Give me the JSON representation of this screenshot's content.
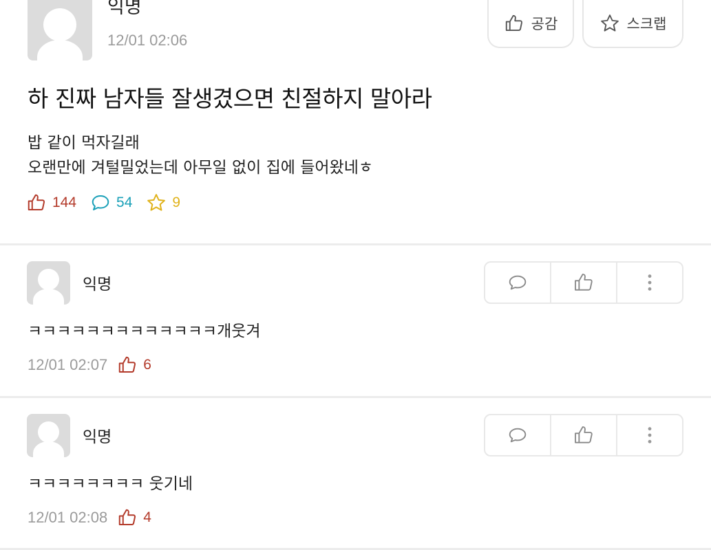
{
  "post": {
    "author": "익명",
    "time": "12/01 02:06",
    "like_button_label": "공감",
    "scrap_button_label": "스크랩",
    "title": "하 진짜 남자들 잘생겼으면 친절하지 말아라",
    "body_line1": "밥 같이 먹자길래",
    "body_line2": "오랜만에 겨털밀었는데 아무일 없이 집에 들어왔네ㅎ",
    "likes": "144",
    "comments": "54",
    "scraps": "9"
  },
  "comments": [
    {
      "author": "익명",
      "text": "ㅋㅋㅋㅋㅋㅋㅋㅋㅋㅋㅋㅋㅋ개웃겨",
      "time": "12/01 02:07",
      "likes": "6"
    },
    {
      "author": "익명",
      "text": "ㅋㅋㅋㅋㅋㅋㅋㅋ 웃기네",
      "time": "12/01 02:08",
      "likes": "4"
    }
  ],
  "colors": {
    "like": "#b33a2a",
    "comment": "#1aa0b8",
    "scrap": "#e0b21a",
    "muted": "#9a9a9a"
  },
  "icons": {
    "like": "thumbs-up-icon",
    "comment": "speech-bubble-icon",
    "scrap": "star-icon",
    "more": "vertical-dots-icon"
  }
}
